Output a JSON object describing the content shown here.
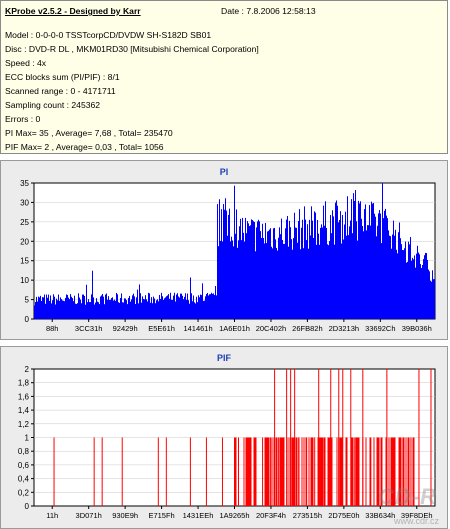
{
  "info": {
    "title": "KProbe v2.5.2 - Designed by Karr",
    "date": "Date : 7.8.2006 12:58:13",
    "lines": [
      "Model : 0-0-0-0 TSSTcorpCD/DVDW SH-S182D SB01",
      "Disc : DVD-R DL , MKM01RD30 [Mitsubishi Chemical Corporation]",
      "Speed : 4x",
      "ECC blocks sum (PI/PIF) : 8/1",
      "Scanned range : 0 - 4171711",
      "Sampling count : 245362",
      "Errors : 0",
      "PI Max= 35 , Average= 7,68 , Total= 235470",
      "PIF Max= 2 , Average= 0,03 , Total= 1056"
    ]
  },
  "pi_chart": {
    "title": "PI",
    "y_ticks": [
      "0",
      "5",
      "10",
      "15",
      "20",
      "25",
      "30",
      "35"
    ],
    "x_ticks": [
      "88h",
      "3CC31h",
      "92429h",
      "E5E61h",
      "141461h",
      "1A6E01h",
      "20C402h",
      "26FB82h",
      "2D3213h",
      "33692Ch",
      "39B036h"
    ]
  },
  "pif_chart": {
    "title": "PIF",
    "y_ticks": [
      "0",
      "0,2",
      "0,4",
      "0,6",
      "0,8",
      "1",
      "1,2",
      "1,4",
      "1,6",
      "1,8",
      "2"
    ],
    "x_ticks": [
      "11h",
      "3D071h",
      "930E9h",
      "E715Fh",
      "1431EEh",
      "1A9265h",
      "20F3F4h",
      "273515h",
      "2D75E0h",
      "33B634h",
      "39F8DEh"
    ]
  },
  "watermark": {
    "logo": "CD-R",
    "url": "www.cdr.cz"
  },
  "chart_data": [
    {
      "type": "bar",
      "title": "PI",
      "color": "#0000ff",
      "ylim": [
        0,
        35
      ],
      "profile": [
        [
          0,
          5,
          1.5
        ],
        [
          0.45,
          5.5,
          1.5
        ],
        [
          0.455,
          10,
          5
        ],
        [
          0.47,
          26,
          6
        ],
        [
          0.53,
          22,
          5
        ],
        [
          0.6,
          22,
          5
        ],
        [
          0.7,
          24,
          6
        ],
        [
          0.8,
          26,
          6
        ],
        [
          0.88,
          24,
          5
        ],
        [
          0.95,
          16,
          4
        ],
        [
          1,
          12,
          3
        ]
      ]
    },
    {
      "type": "bar",
      "title": "PIF",
      "color": "#ff0000",
      "ylim": [
        0,
        2
      ],
      "ones": [
        0.05,
        0.15,
        0.17,
        0.22,
        0.31,
        0.33,
        0.39,
        0.43,
        0.47,
        0.5,
        0.51,
        0.53,
        0.55,
        0.57,
        0.59,
        0.61,
        0.62,
        0.64,
        0.66,
        0.68,
        0.7,
        0.72,
        0.74,
        0.76,
        0.78,
        0.8,
        0.82,
        0.84,
        0.86,
        0.88,
        0.9,
        0.92,
        0.94
      ],
      "twos": [
        0.6,
        0.63,
        0.64,
        0.65,
        0.71,
        0.74,
        0.76,
        0.77,
        0.79,
        0.82,
        0.88,
        0.96,
        0.99
      ]
    }
  ]
}
